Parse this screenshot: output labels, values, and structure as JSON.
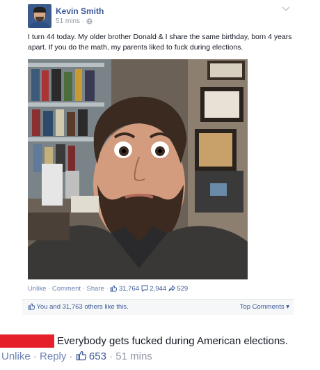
{
  "post": {
    "author": "Kevin Smith",
    "time": "51 mins · ",
    "globe_icon": "globe-icon",
    "text": "I turn 44 today. My older brother Donald & I share the same birthday, born 4 years apart. If you do the math, my parents liked to fuck during elections.",
    "chevron_icon": "chevron-down-icon"
  },
  "actions": {
    "unlike": "Unlike",
    "sep": " · ",
    "comment": "Comment",
    "share": "Share",
    "likes": "31,764",
    "comments": "2,944",
    "shares": "529"
  },
  "likebar": {
    "text": "You and 31,763 others like this.",
    "top_comments": "Top Comments ▾"
  },
  "comment": {
    "text": "Everybody gets fucked during American elections.",
    "unlike": "Unlike",
    "reply": "Reply",
    "likes": "653",
    "time": "51 mins"
  },
  "colors": {
    "link": "#3b5998",
    "muted": "#9197a3",
    "redaction": "#e5202a"
  }
}
